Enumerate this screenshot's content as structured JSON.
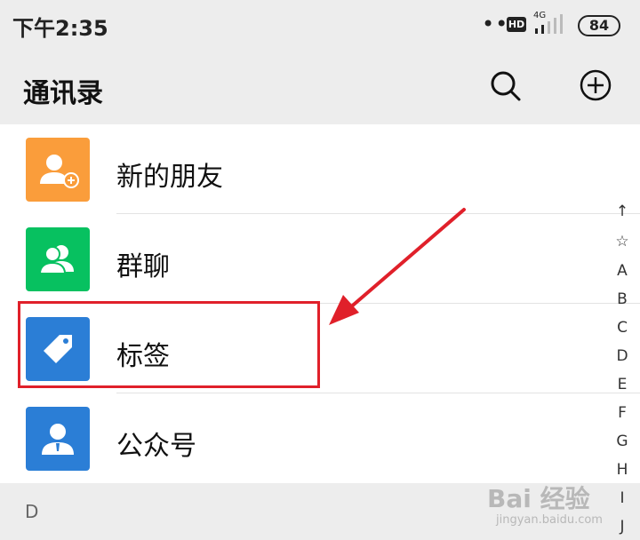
{
  "status_bar": {
    "time": "下午2:35",
    "network": "4G",
    "hd": "HD",
    "battery": "84"
  },
  "header": {
    "title": "通讯录"
  },
  "contacts": [
    {
      "label": "新的朋友",
      "icon": "add-friend-icon",
      "color": "#fa9d3b"
    },
    {
      "label": "群聊",
      "icon": "group-chat-icon",
      "color": "#07c160"
    },
    {
      "label": "标签",
      "icon": "tag-icon",
      "color": "#2b7ed6"
    },
    {
      "label": "公众号",
      "icon": "official-account-icon",
      "color": "#2b7ed6"
    }
  ],
  "section": {
    "letter": "D"
  },
  "index_bar": [
    "↑",
    "☆",
    "A",
    "B",
    "C",
    "D",
    "E",
    "F",
    "G",
    "H",
    "I",
    "J"
  ],
  "annotation": {
    "color": "#e0202a"
  },
  "watermark": {
    "main": "Bai 经验",
    "sub": "jingyan.baidu.com"
  }
}
